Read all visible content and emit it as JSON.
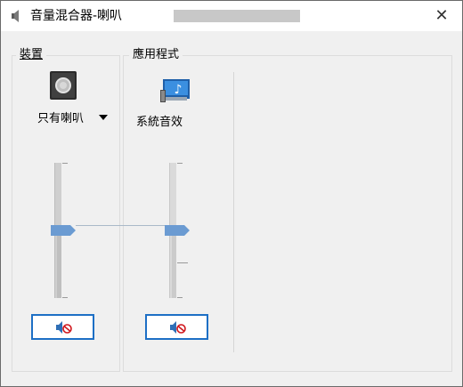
{
  "window": {
    "title": "音量混合器-喇叭",
    "close_symbol": "✕"
  },
  "device_section": {
    "label": "裝置",
    "device_name": "只有喇叭",
    "volume_percent": 50,
    "mute_icon": "speaker-muted-icon"
  },
  "apps_section": {
    "label": "應用程式",
    "apps": [
      {
        "name": "系統音效",
        "volume_percent": 50,
        "mute_icon": "speaker-muted-icon"
      }
    ]
  },
  "colors": {
    "accent": "#1d6fc5",
    "thumb": "#6b9bd2"
  }
}
